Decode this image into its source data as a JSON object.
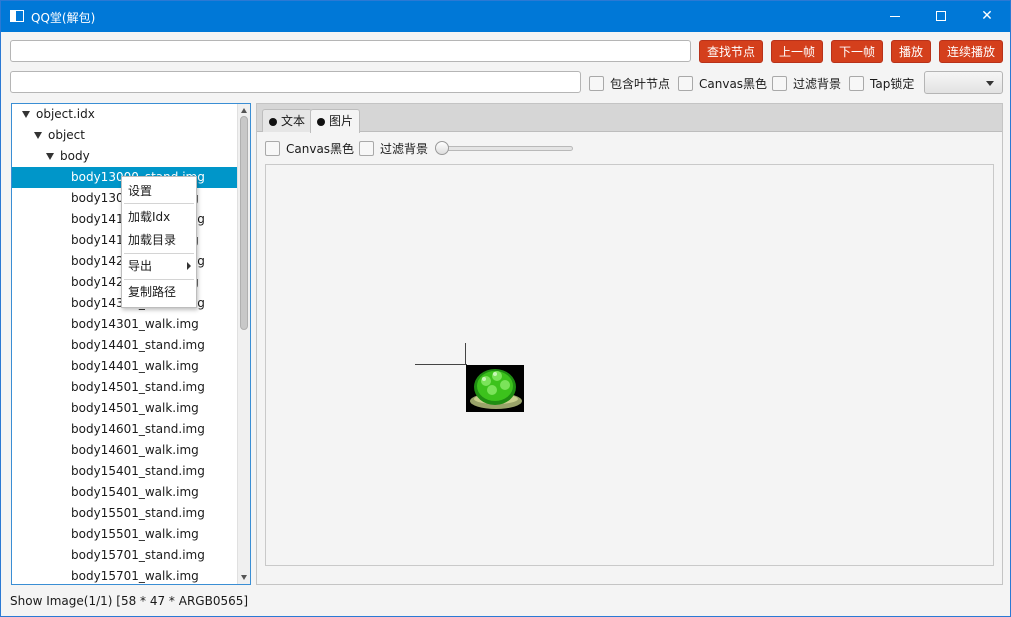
{
  "window": {
    "title": "QQ堂(解包)"
  },
  "window_controls": {
    "minimize": "minimize-icon",
    "maximize": "maximize-icon",
    "close": "✕"
  },
  "toolbar": {
    "search_value": "",
    "path_value": "",
    "buttons": [
      "查找节点",
      "上一帧",
      "下一帧",
      "播放",
      "连续播放"
    ],
    "checkboxes": [
      "包含叶节点",
      "Canvas黑色",
      "过滤背景",
      "Tap锁定"
    ],
    "combo_value": ""
  },
  "tree": {
    "items": [
      {
        "label": "object.idx",
        "level": 0,
        "expanded": true
      },
      {
        "label": "object",
        "level": 1,
        "expanded": true
      },
      {
        "label": "body",
        "level": 2,
        "expanded": true
      },
      {
        "label": "body13000_stand.img",
        "level": 3,
        "selected": true
      },
      {
        "label": "body13001_walk.img",
        "level": 3
      },
      {
        "label": "body14101_stand.img",
        "level": 3
      },
      {
        "label": "body14101_walk.img",
        "level": 3
      },
      {
        "label": "body14201_stand.img",
        "level": 3
      },
      {
        "label": "body14201_walk.img",
        "level": 3
      },
      {
        "label": "body14301_stand.img",
        "level": 3
      },
      {
        "label": "body14301_walk.img",
        "level": 3
      },
      {
        "label": "body14401_stand.img",
        "level": 3
      },
      {
        "label": "body14401_walk.img",
        "level": 3
      },
      {
        "label": "body14501_stand.img",
        "level": 3
      },
      {
        "label": "body14501_walk.img",
        "level": 3
      },
      {
        "label": "body14601_stand.img",
        "level": 3
      },
      {
        "label": "body14601_walk.img",
        "level": 3
      },
      {
        "label": "body15401_stand.img",
        "level": 3
      },
      {
        "label": "body15401_walk.img",
        "level": 3
      },
      {
        "label": "body15501_stand.img",
        "level": 3
      },
      {
        "label": "body15501_walk.img",
        "level": 3
      },
      {
        "label": "body15701_stand.img",
        "level": 3
      },
      {
        "label": "body15701_walk.img",
        "level": 3
      }
    ]
  },
  "context_menu": {
    "items": [
      "设置",
      "加载Idx",
      "加载目录",
      "导出",
      "复制路径"
    ]
  },
  "tabs": [
    {
      "label": "文本",
      "active": false
    },
    {
      "label": "图片",
      "active": true
    }
  ],
  "image_panel": {
    "checkboxes": [
      "Canvas黑色",
      "过滤背景"
    ],
    "slider_value": 0
  },
  "status": "Show Image(1/1) [58 * 47 * ARGB0565]"
}
